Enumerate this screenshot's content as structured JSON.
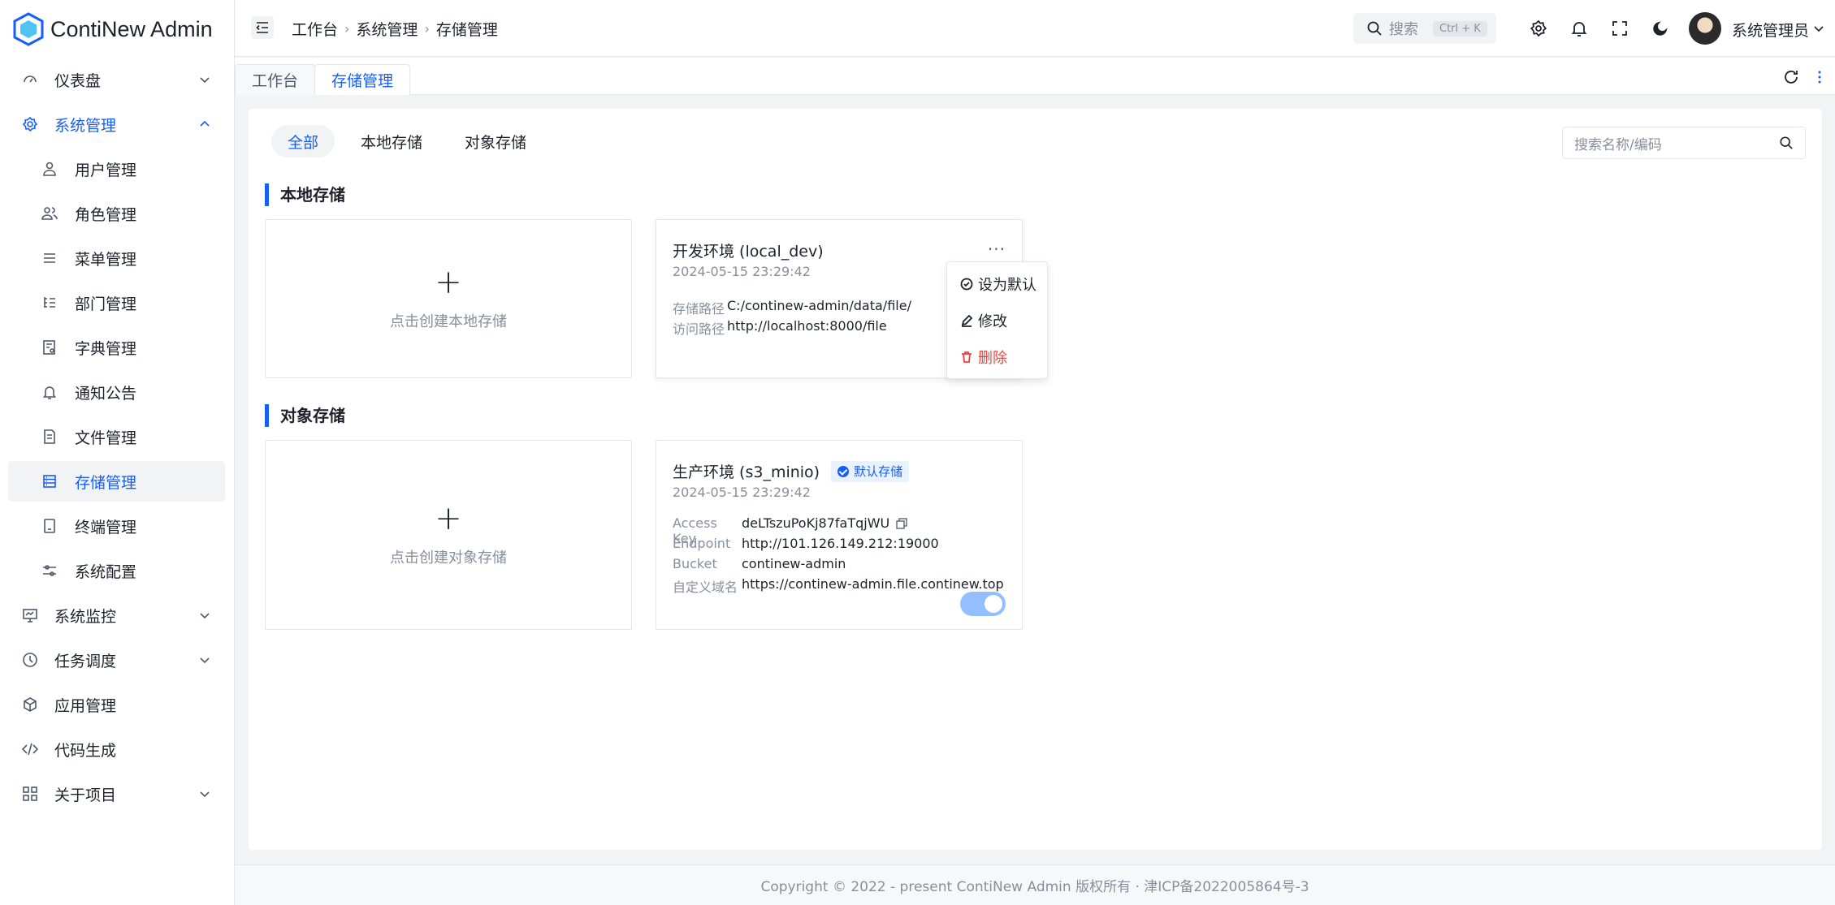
{
  "app": {
    "title": "ContiNew Admin"
  },
  "sidebar": {
    "items": [
      {
        "label": "仪表盘",
        "icon": "dashboard-icon"
      },
      {
        "label": "系统管理",
        "icon": "gear-icon"
      },
      {
        "label": "用户管理",
        "icon": "user-icon"
      },
      {
        "label": "角色管理",
        "icon": "users-icon"
      },
      {
        "label": "菜单管理",
        "icon": "menu-icon"
      },
      {
        "label": "部门管理",
        "icon": "list-tree-icon"
      },
      {
        "label": "字典管理",
        "icon": "dictionary-icon"
      },
      {
        "label": "通知公告",
        "icon": "bell-icon"
      },
      {
        "label": "文件管理",
        "icon": "file-icon"
      },
      {
        "label": "存储管理",
        "icon": "storage-icon"
      },
      {
        "label": "终端管理",
        "icon": "terminal-icon"
      },
      {
        "label": "系统配置",
        "icon": "sliders-icon"
      },
      {
        "label": "系统监控",
        "icon": "monitor-icon"
      },
      {
        "label": "任务调度",
        "icon": "clock-icon"
      },
      {
        "label": "应用管理",
        "icon": "cube-icon"
      },
      {
        "label": "代码生成",
        "icon": "code-icon"
      },
      {
        "label": "关于项目",
        "icon": "grid-icon"
      }
    ]
  },
  "header": {
    "breadcrumb": [
      "工作台",
      "系统管理",
      "存储管理"
    ],
    "search_placeholder": "搜索",
    "search_shortcut": "Ctrl + K",
    "user_name": "系统管理员"
  },
  "page_tabs": [
    "工作台",
    "存储管理"
  ],
  "main": {
    "filter_tabs": [
      "全部",
      "本地存储",
      "对象存储"
    ],
    "search_placeholder": "搜索名称/编码",
    "local": {
      "title": "本地存储",
      "create_label": "点击创建本地存储",
      "card": {
        "name": "开发环境 (local_dev)",
        "time": "2024-05-15 23:29:42",
        "path_label": "存储路径",
        "path_value": "C:/continew-admin/data/file/",
        "access_label": "访问路径",
        "access_value": "http://localhost:8000/file"
      },
      "menu": {
        "set_default": "设为默认",
        "edit": "修改",
        "delete": "删除"
      }
    },
    "object": {
      "title": "对象存储",
      "create_label": "点击创建对象存储",
      "card": {
        "name": "生产环境 (s3_minio)",
        "badge": "默认存储",
        "time": "2024-05-15 23:29:42",
        "ak_label": "Access Key",
        "ak_value": "deLTszuPoKj87faTqjWU",
        "endpoint_label": "Endpoint",
        "endpoint_value": "http://101.126.149.212:19000",
        "bucket_label": "Bucket",
        "bucket_value": "continew-admin",
        "domain_label": "自定义域名",
        "domain_value": "https://continew-admin.file.continew.top",
        "enabled": true
      }
    }
  },
  "footer": {
    "text": "Copyright © 2022 - present ContiNew Admin 版权所有 · 津ICP备2022005864号-3"
  },
  "colors": {
    "accent": "#165dff",
    "danger": "#f53f3f",
    "toggle": "#94bfff"
  }
}
